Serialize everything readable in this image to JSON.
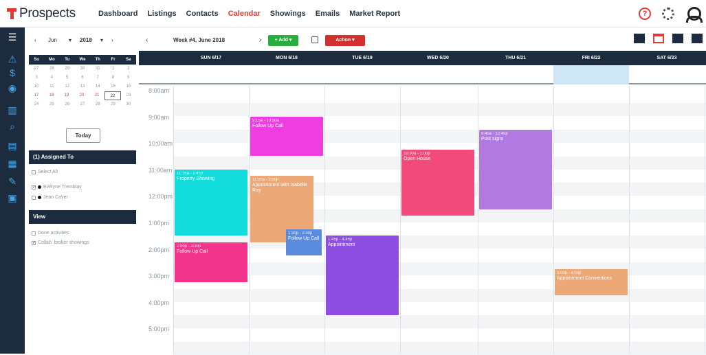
{
  "app": {
    "name": "Prospects"
  },
  "nav": [
    {
      "label": "Dashboard",
      "active": false
    },
    {
      "label": "Listings",
      "active": false
    },
    {
      "label": "Contacts",
      "active": false
    },
    {
      "label": "Calendar",
      "active": true
    },
    {
      "label": "Showings",
      "active": false
    },
    {
      "label": "Emails",
      "active": false
    },
    {
      "label": "Market Report",
      "active": false
    }
  ],
  "colors": {
    "brand": "#e53935",
    "navy": "#1c2c3e",
    "add": "#27ae3c",
    "action": "#d32f2f",
    "highlight": "#cfe6f7"
  },
  "mini_calendar": {
    "month": "Jun",
    "year": "2018",
    "weekdays": [
      "Su",
      "Mo",
      "Tu",
      "We",
      "Th",
      "Fr",
      "Sa"
    ],
    "weeks": [
      [
        "27",
        "28",
        "29",
        "30",
        "31",
        "1",
        "2"
      ],
      [
        "3",
        "4",
        "5",
        "6",
        "7",
        "8",
        "9"
      ],
      [
        "10",
        "11",
        "12",
        "13",
        "14",
        "15",
        "16"
      ],
      [
        "17",
        "18",
        "19",
        "20",
        "21",
        "22",
        "23"
      ],
      [
        "24",
        "25",
        "26",
        "27",
        "28",
        "29",
        "30"
      ]
    ],
    "today_label": "Today"
  },
  "assigned": {
    "title": "(1) Assigned To",
    "select_all": "Select All",
    "people": [
      {
        "name": "Evelyne Tremblay",
        "checked": true
      },
      {
        "name": "Jean Cayer",
        "checked": false
      }
    ]
  },
  "view": {
    "title": "View",
    "options": [
      {
        "label": "Done activities",
        "checked": false
      },
      {
        "label": "Collab. broker showings",
        "checked": true
      }
    ]
  },
  "toolbar": {
    "week_label": "Week #4, June 2018",
    "add_label": "+ Add ▾",
    "action_label": "Action ▾"
  },
  "days": [
    "SUN 6/17",
    "MON 6/18",
    "TUE 6/19",
    "WED 6/20",
    "THU 6/21",
    "FRI 6/22",
    "SAT 6/23"
  ],
  "times": [
    "8:00am",
    "9:00am",
    "10:00am",
    "11:00am",
    "12:00pm",
    "1:00pm",
    "2:00pm",
    "3:00pm",
    "4:00pm",
    "5:00pm"
  ],
  "events": [
    {
      "day": 0,
      "start": 11.0,
      "end": 13.5,
      "time": "11:15a - 1:45p",
      "title": "Property Showing",
      "color": "#12dcdc"
    },
    {
      "day": 0,
      "start": 13.75,
      "end": 15.25,
      "time": "2:00p - 3:30p",
      "title": "Follow Up Call",
      "color": "#f2358a"
    },
    {
      "day": 1,
      "start": 9.0,
      "end": 10.5,
      "time": "9:15a - 10:30a",
      "title": "Follow Up Call",
      "color": "#ee3de0"
    },
    {
      "day": 1,
      "start": 11.25,
      "end": 13.75,
      "time": "11:30a - 2:00p",
      "title": "Appointment with Isabelle Roy",
      "color": "#eda877"
    },
    {
      "day": 1,
      "start": 13.25,
      "end": 14.25,
      "time": "1:30p - 2:30p",
      "title": "Follow Up Call",
      "color": "#5b8bdf"
    },
    {
      "day": 2,
      "start": 13.5,
      "end": 16.5,
      "time": "1:45p - 4:45p",
      "title": "Appointment",
      "color": "#8d4de0"
    },
    {
      "day": 3,
      "start": 10.25,
      "end": 12.75,
      "time": "10:30a - 1:00p",
      "title": "Open House",
      "color": "#f24a7a"
    },
    {
      "day": 4,
      "start": 9.5,
      "end": 12.5,
      "time": "9:45a - 12:45p",
      "title": "Post signs",
      "color": "#b27ae0"
    },
    {
      "day": 5,
      "start": 14.75,
      "end": 15.75,
      "time": "3:00p - 4:00p",
      "title": "Appointment Conventions",
      "color": "#eda877"
    }
  ]
}
